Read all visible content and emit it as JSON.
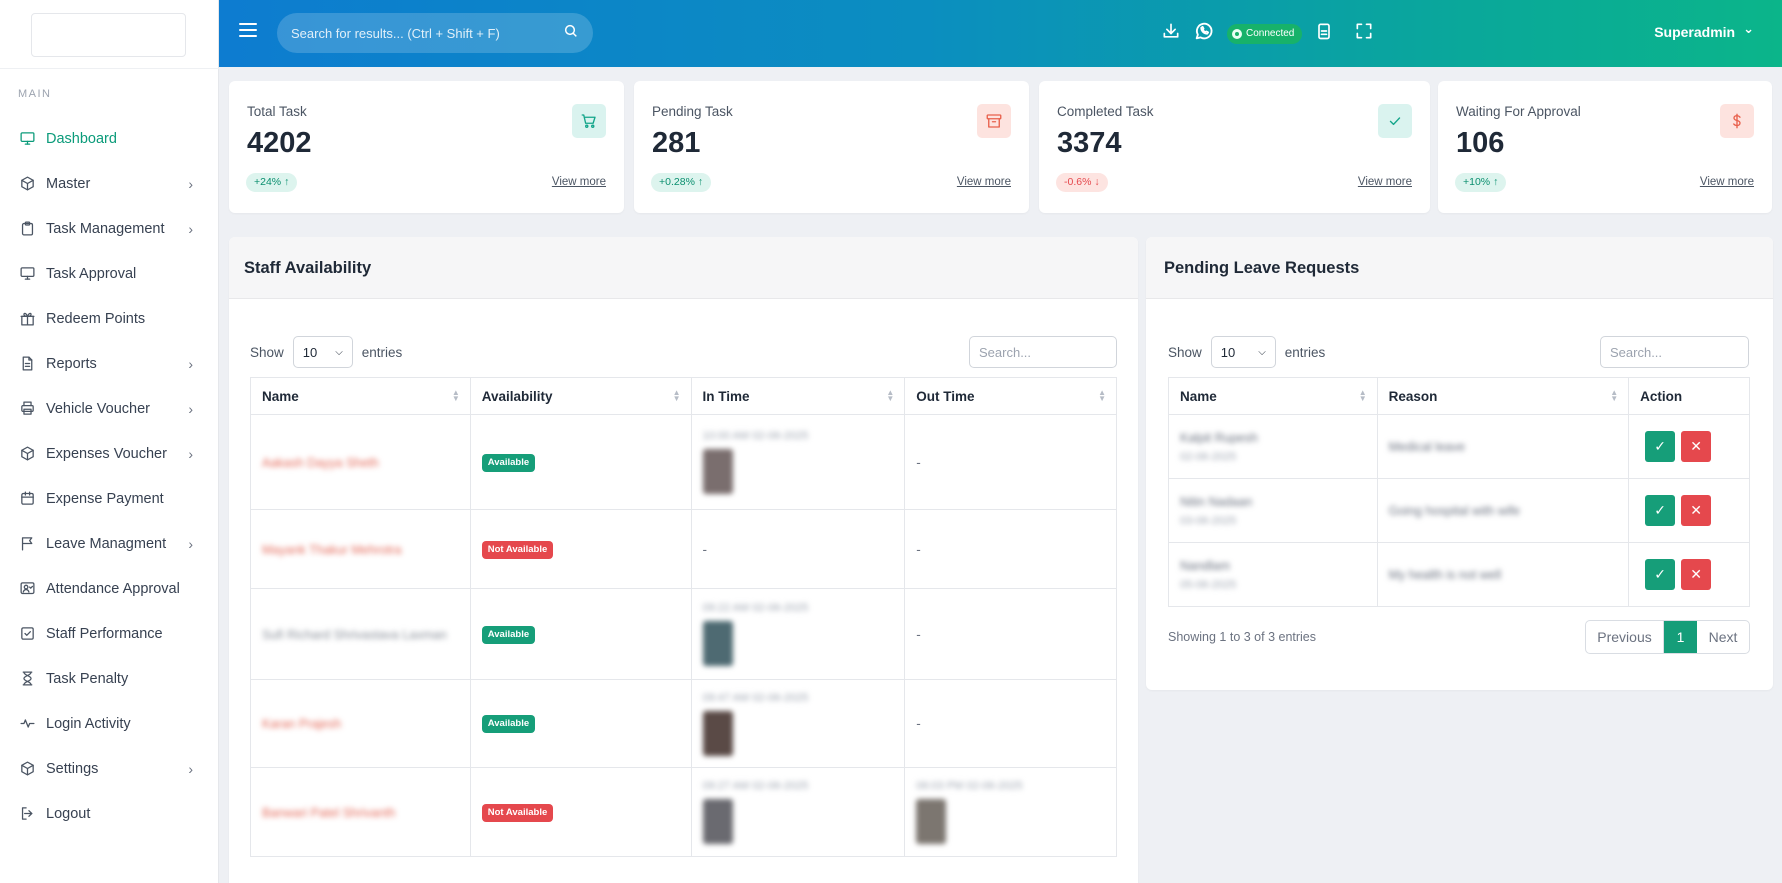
{
  "sidebar": {
    "section_label": "MAIN",
    "items": [
      {
        "label": "Dashboard",
        "icon": "monitor-icon",
        "has_chevron": false,
        "active": true
      },
      {
        "label": "Master",
        "icon": "cube-icon",
        "has_chevron": true
      },
      {
        "label": "Task Management",
        "icon": "clipboard-icon",
        "has_chevron": true
      },
      {
        "label": "Task Approval",
        "icon": "monitor-icon",
        "has_chevron": false
      },
      {
        "label": "Redeem Points",
        "icon": "gift-icon",
        "has_chevron": false
      },
      {
        "label": "Reports",
        "icon": "file-icon",
        "has_chevron": true
      },
      {
        "label": "Vehicle Voucher",
        "icon": "printer-icon",
        "has_chevron": true
      },
      {
        "label": "Expenses Voucher",
        "icon": "cube-icon",
        "has_chevron": true
      },
      {
        "label": "Expense Payment",
        "icon": "calendar-icon",
        "has_chevron": false
      },
      {
        "label": "Leave Managment",
        "icon": "flag-icon",
        "has_chevron": true
      },
      {
        "label": "Attendance Approval",
        "icon": "user-check-icon",
        "has_chevron": false
      },
      {
        "label": "Staff Performance",
        "icon": "check-square-icon",
        "has_chevron": false
      },
      {
        "label": "Task Penalty",
        "icon": "hourglass-icon",
        "has_chevron": false
      },
      {
        "label": "Login Activity",
        "icon": "activity-icon",
        "has_chevron": false
      },
      {
        "label": "Settings",
        "icon": "cube-icon",
        "has_chevron": true
      },
      {
        "label": "Logout",
        "icon": "logout-icon",
        "has_chevron": false
      }
    ]
  },
  "header": {
    "search_placeholder": "Search for results... (Ctrl + Shift + F)",
    "connected_label": "Connected",
    "user_name": "Superadmin",
    "user_chevron": "⌄"
  },
  "stats": [
    {
      "title": "Total Task",
      "value": "4202",
      "badge": "+24% ↑",
      "trend": "up",
      "link": "View more",
      "icon": "cart-icon"
    },
    {
      "title": "Pending Task",
      "value": "281",
      "badge": "+0.28% ↑",
      "trend": "up",
      "link": "View more",
      "icon": "archive-icon"
    },
    {
      "title": "Completed Task",
      "value": "3374",
      "badge": "-0.6% ↓",
      "trend": "down",
      "link": "View more",
      "icon": "check-icon"
    },
    {
      "title": "Waiting For Approval",
      "value": "106",
      "badge": "+10% ↑",
      "trend": "up",
      "link": "View more",
      "icon": "dollar-icon"
    }
  ],
  "staff": {
    "title": "Staff Availability",
    "show_label": "Show",
    "entries_label": "entries",
    "page_size": "10",
    "search_placeholder": "Search...",
    "columns": [
      "Name",
      "Availability",
      "In Time",
      "Out Time"
    ],
    "rows": [
      {
        "name": "Aakash Dayya Sheth",
        "status": "Available",
        "available": true,
        "in_time": "10:00 AM 02-06-2025",
        "has_in_photo": true,
        "out_time": "-",
        "has_out_photo": false
      },
      {
        "name": "Mayank Thakur Mehrotra",
        "status": "Not Available",
        "available": false,
        "in_time": "-",
        "has_in_photo": false,
        "out_time": "-",
        "has_out_photo": false
      },
      {
        "name": "Sufi Richard Shrivastava Laxman",
        "status": "Available",
        "available": true,
        "in_time": "09:22 AM 02-06-2025",
        "has_in_photo": true,
        "out_time": "-",
        "has_out_photo": false
      },
      {
        "name": "Karan Prajesh",
        "status": "Available",
        "available": true,
        "in_time": "09:47 AM 02-06-2025",
        "has_in_photo": true,
        "out_time": "-",
        "has_out_photo": false
      },
      {
        "name": "Banwari Patel Shrivanth",
        "status": "Not Available",
        "available": false,
        "in_time": "09:27 AM 02-06-2025",
        "has_in_photo": true,
        "out_time": "06:03 PM 02-06-2025",
        "has_out_photo": true
      }
    ]
  },
  "leave": {
    "title": "Pending Leave Requests",
    "show_label": "Show",
    "entries_label": "entries",
    "page_size": "10",
    "search_placeholder": "Search...",
    "columns": [
      "Name",
      "Reason",
      "Action"
    ],
    "rows": [
      {
        "name": "Kalpit Rupesh",
        "date": "02-06-2025",
        "reason": "Medical leave"
      },
      {
        "name": "Nitin Nadaan",
        "date": "03-06-2025",
        "reason": "Going hospital with wife"
      },
      {
        "name": "Nandlam",
        "date": "05-06-2025",
        "reason": "My health is not well"
      }
    ],
    "approve_glyph": "✓",
    "reject_glyph": "✕",
    "showing_text": "Showing 1 to 3 of 3 entries",
    "prev_label": "Previous",
    "page_num": "1",
    "next_label": "Next"
  },
  "colors": {
    "accent": "#0b9b7a",
    "header_start": "#0d7cd0",
    "header_end": "#0bb58a",
    "danger": "#e5484d"
  }
}
